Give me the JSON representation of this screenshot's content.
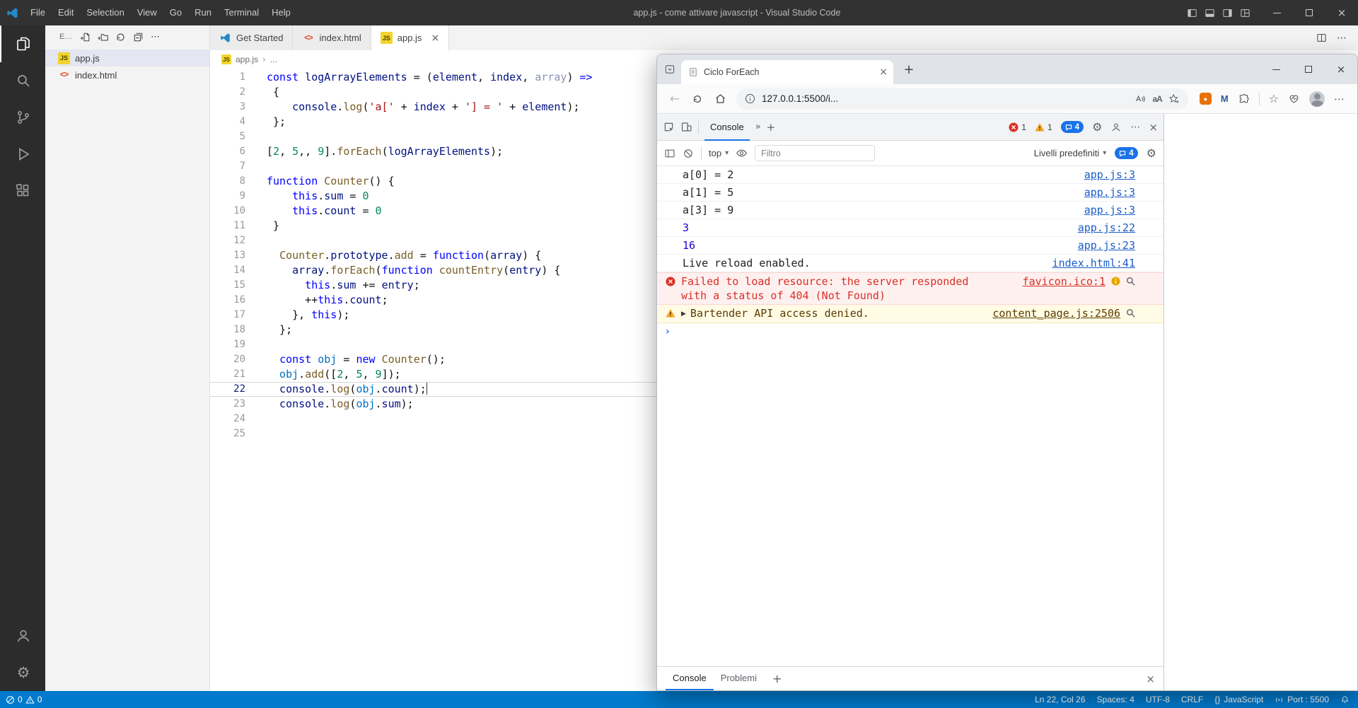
{
  "vscode": {
    "titlebar": {
      "menus": [
        "File",
        "Edit",
        "Selection",
        "View",
        "Go",
        "Run",
        "Terminal",
        "Help"
      ],
      "title": "app.js - come attivare javascript - Visual Studio Code"
    },
    "explorer": {
      "header": "E...",
      "files": [
        {
          "name": "app.js",
          "icon": "js",
          "selected": true
        },
        {
          "name": "index.html",
          "icon": "html",
          "selected": false
        }
      ]
    },
    "tabs": [
      {
        "label": "Get Started",
        "icon": "vscode",
        "active": false,
        "close": false
      },
      {
        "label": "index.html",
        "icon": "html",
        "active": false,
        "close": false
      },
      {
        "label": "app.js",
        "icon": "js",
        "active": true,
        "close": true
      }
    ],
    "breadcrumb": {
      "file": "app.js",
      "ellipsis": "..."
    },
    "editor": {
      "current_line": 22,
      "lines": [
        [
          [
            "const",
            "k"
          ],
          [
            " logArrayElements",
            "v"
          ],
          [
            " = (",
            "p"
          ],
          [
            "element",
            "v"
          ],
          [
            ", ",
            "p"
          ],
          [
            "index",
            "v"
          ],
          [
            ", ",
            "p"
          ],
          [
            "array",
            "dim"
          ],
          [
            ") ",
            "p"
          ],
          [
            "=>",
            "k"
          ]
        ],
        [
          [
            " {",
            "p"
          ]
        ],
        [
          [
            "    console",
            "v"
          ],
          [
            ".",
            "p"
          ],
          [
            "log",
            "f"
          ],
          [
            "(",
            "p"
          ],
          [
            "'a['",
            "s"
          ],
          [
            " + ",
            "p"
          ],
          [
            "index",
            "v"
          ],
          [
            " + ",
            "p"
          ],
          [
            "'] = '",
            "s"
          ],
          [
            " + ",
            "p"
          ],
          [
            "element",
            "v"
          ],
          [
            ");",
            "p"
          ]
        ],
        [
          [
            " };",
            "p"
          ]
        ],
        [],
        [
          [
            "[",
            "p"
          ],
          [
            "2",
            "n"
          ],
          [
            ", ",
            "p"
          ],
          [
            "5",
            "n"
          ],
          [
            ",, ",
            "p"
          ],
          [
            "9",
            "n"
          ],
          [
            "].",
            "p"
          ],
          [
            "forEach",
            "f"
          ],
          [
            "(",
            "p"
          ],
          [
            "logArrayElements",
            "v"
          ],
          [
            ");",
            "p"
          ]
        ],
        [],
        [
          [
            "function",
            "k"
          ],
          [
            " ",
            "p"
          ],
          [
            "Counter",
            "f"
          ],
          [
            "() {",
            "p"
          ]
        ],
        [
          [
            "    this",
            "k"
          ],
          [
            ".",
            "p"
          ],
          [
            "sum",
            "v"
          ],
          [
            " = ",
            "p"
          ],
          [
            "0",
            "n"
          ]
        ],
        [
          [
            "    this",
            "k"
          ],
          [
            ".",
            "p"
          ],
          [
            "count",
            "v"
          ],
          [
            " = ",
            "p"
          ],
          [
            "0",
            "n"
          ]
        ],
        [
          [
            " }",
            "p"
          ]
        ],
        [],
        [
          [
            "  ",
            "p"
          ],
          [
            "Counter",
            "f"
          ],
          [
            ".",
            "p"
          ],
          [
            "prototype",
            "v"
          ],
          [
            ".",
            "p"
          ],
          [
            "add",
            "f"
          ],
          [
            " = ",
            "p"
          ],
          [
            "function",
            "k"
          ],
          [
            "(",
            "p"
          ],
          [
            "array",
            "v"
          ],
          [
            ") {",
            "p"
          ]
        ],
        [
          [
            "    array",
            "v"
          ],
          [
            ".",
            "p"
          ],
          [
            "forEach",
            "f"
          ],
          [
            "(",
            "p"
          ],
          [
            "function",
            "k"
          ],
          [
            " ",
            "p"
          ],
          [
            "countEntry",
            "f"
          ],
          [
            "(",
            "p"
          ],
          [
            "entry",
            "v"
          ],
          [
            ") {",
            "p"
          ]
        ],
        [
          [
            "      this",
            "k"
          ],
          [
            ".",
            "p"
          ],
          [
            "sum",
            "v"
          ],
          [
            " += ",
            "p"
          ],
          [
            "entry",
            "v"
          ],
          [
            ";",
            "p"
          ]
        ],
        [
          [
            "      ++",
            "p"
          ],
          [
            "this",
            "k"
          ],
          [
            ".",
            "p"
          ],
          [
            "count",
            "v"
          ],
          [
            ";",
            "p"
          ]
        ],
        [
          [
            "    }, ",
            "p"
          ],
          [
            "this",
            "k"
          ],
          [
            ");",
            "p"
          ]
        ],
        [
          [
            "  };",
            "p"
          ]
        ],
        [],
        [
          [
            "  ",
            "p"
          ],
          [
            "const",
            "k"
          ],
          [
            " obj",
            "c"
          ],
          [
            " = ",
            "p"
          ],
          [
            "new",
            "k"
          ],
          [
            " ",
            "p"
          ],
          [
            "Counter",
            "f"
          ],
          [
            "();",
            "p"
          ]
        ],
        [
          [
            "  obj",
            "c"
          ],
          [
            ".",
            "p"
          ],
          [
            "add",
            "f"
          ],
          [
            "([",
            "p"
          ],
          [
            "2",
            "n"
          ],
          [
            ", ",
            "p"
          ],
          [
            "5",
            "n"
          ],
          [
            ", ",
            "p"
          ],
          [
            "9",
            "n"
          ],
          [
            "]);",
            "p"
          ]
        ],
        [
          [
            "  console",
            "v"
          ],
          [
            ".",
            "p"
          ],
          [
            "log",
            "f"
          ],
          [
            "(",
            "p"
          ],
          [
            "obj",
            "c"
          ],
          [
            ".",
            "p"
          ],
          [
            "count",
            "v"
          ],
          [
            ");",
            "p"
          ]
        ],
        [
          [
            "  console",
            "v"
          ],
          [
            ".",
            "p"
          ],
          [
            "log",
            "f"
          ],
          [
            "(",
            "p"
          ],
          [
            "obj",
            "c"
          ],
          [
            ".",
            "p"
          ],
          [
            "sum",
            "v"
          ],
          [
            ");",
            "p"
          ]
        ],
        [],
        []
      ]
    },
    "statusbar": {
      "errors": "0",
      "warnings": "0",
      "cursor": "Ln 22, Col 26",
      "indent": "Spaces: 4",
      "encoding": "UTF-8",
      "eol": "CRLF",
      "language": "JavaScript",
      "port": "Port : 5500"
    }
  },
  "browser": {
    "tab_title": "Ciclo ForEach",
    "url": "127.0.0.1:5500/i...",
    "devtools": {
      "active_tab": "Console",
      "badges": {
        "errors": "1",
        "issues": "1",
        "messages": "4"
      },
      "toolbar": {
        "context": "top",
        "filter_placeholder": "Filtro",
        "levels": "Livelli predefiniti",
        "messages": "4"
      },
      "rows": [
        {
          "type": "log",
          "text": "a[0] = 2",
          "link": "app.js:3"
        },
        {
          "type": "log",
          "text": "a[1] = 5",
          "link": "app.js:3"
        },
        {
          "type": "log",
          "text": "a[3] = 9",
          "link": "app.js:3"
        },
        {
          "type": "number",
          "text": "3",
          "link": "app.js:22"
        },
        {
          "type": "number",
          "text": "16",
          "link": "app.js:23"
        },
        {
          "type": "log",
          "text": "Live reload enabled.",
          "link": "index.html:41"
        },
        {
          "type": "error",
          "text": "Failed to load resource: the server responded with a status of 404 (Not Found)",
          "link": "favicon.ico:1"
        },
        {
          "type": "warning",
          "text": "Bartender API access denied.",
          "link": "content_page.js:2506"
        },
        {
          "type": "prompt",
          "text": "",
          "link": ""
        }
      ],
      "drawer_tabs": [
        {
          "label": "Console",
          "active": true
        },
        {
          "label": "Problemi",
          "active": false
        }
      ]
    }
  }
}
